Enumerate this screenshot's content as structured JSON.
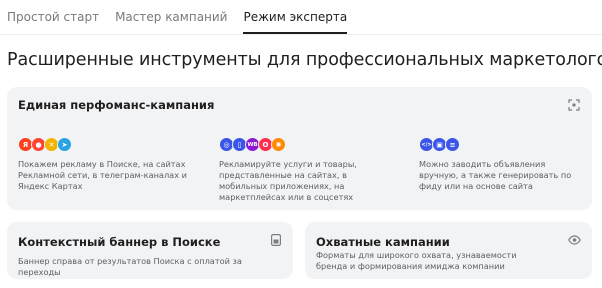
{
  "tabs": [
    {
      "label": "Простой старт",
      "active": false
    },
    {
      "label": "Мастер кампаний",
      "active": false
    },
    {
      "label": "Режим эксперта",
      "active": true
    }
  ],
  "heading": "Расширенные инструменты для профессиональных маркетологов",
  "performance_card": {
    "title": "Единая перфоманс-кампания",
    "features": [
      {
        "icons": [
          "yandex-icon",
          "maps-pin-icon",
          "network-icon",
          "telegram-icon"
        ],
        "text": "Покажем рекламу в Поиске, на сайтах Рекламной сети, в телеграм-каналах и Яндекс Картах"
      },
      {
        "icons": [
          "globe-icon",
          "phone-icon",
          "wb-marketplace-icon",
          "ozon-marketplace-icon",
          "social-icon"
        ],
        "text": "Рекламируйте услуги и товары, представленные на сайтах, в мобильных приложениях, на маркетплейсах или в соцсетях"
      },
      {
        "icons": [
          "code-icon",
          "feed-icon",
          "list-icon"
        ],
        "text": "Можно заводить объявления вручную, а также генерировать по фиду или на основе сайта"
      }
    ]
  },
  "context_banner_card": {
    "title": "Контекстный баннер в Поиске",
    "text": "Баннер справа от результатов Поиска с оплатой за переходы"
  },
  "reach_card": {
    "title": "Охватные кампании",
    "text": "Форматы для широкого охвата, узнаваемости бренда и формирования имиджа компании"
  },
  "icon_labels": {
    "wb": "WB",
    "code": "</>"
  },
  "colors": {
    "active_tab_underline": "#1f1f1f",
    "card_bg": "#f2f3f5",
    "muted_text": "#5f6063"
  }
}
